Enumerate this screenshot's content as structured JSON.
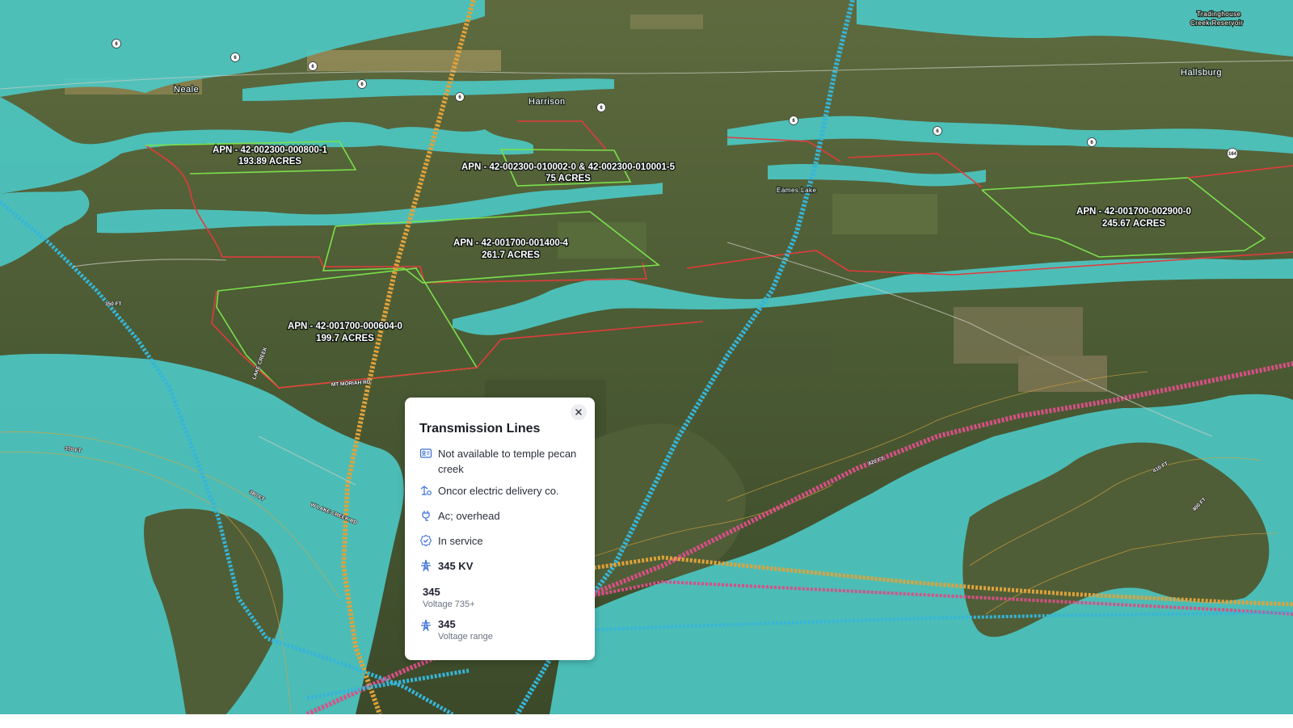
{
  "map": {
    "places": [
      "Neale",
      "Harrison",
      "Hallsburg",
      "Eames Lake",
      "Tradinghouse",
      "Creek Reservoir"
    ],
    "parcels": [
      {
        "apn": "APN - 42-002300-000800-1",
        "acres": "193.89 ACRES"
      },
      {
        "apn": "APN - 42-002300-010002-0 & 42-002300-010001-5",
        "acres": "75 ACRES"
      },
      {
        "apn": "APN - 42-001700-001400-4",
        "acres": "261.7 ACRES"
      },
      {
        "apn": "APN - 42-001700-000604-0",
        "acres": "199.7 ACRES"
      },
      {
        "apn": "APN - 42-001700-002900-0",
        "acres": "245.67 ACRES"
      }
    ],
    "contours": [
      "370 FT",
      "380 FT",
      "400 FT",
      "410 FT",
      "420 FT",
      "350 FT"
    ],
    "roads": [
      "W LAKE CREEK RD",
      "MT MORIAH RD",
      "LAKE CREEK"
    ],
    "shields": [
      "6",
      "6",
      "6",
      "6",
      "6",
      "6",
      "6",
      "6",
      "6",
      "164"
    ],
    "colors": {
      "water": "#4cc9c5",
      "transmission_cyan": "#36b5d8",
      "transmission_orange": "#e0a23a",
      "transmission_pink": "#d94f86",
      "parcel_green": "#7be04a",
      "parcel_red": "#e33b3b"
    }
  },
  "popup": {
    "title": "Transmission Lines",
    "availability": "Not available to temple pecan creek",
    "owner": "Oncor electric delivery co.",
    "type": "Ac; overhead",
    "status": "In service",
    "kv": "345 KV",
    "voltage_value": "345",
    "voltage_label": "Voltage 735+",
    "range_value": "345",
    "range_label": "Voltage range",
    "icons": [
      "id-card-icon",
      "power-line-icon",
      "plug-icon",
      "check-badge-icon",
      "tower-icon",
      "tower-icon"
    ]
  }
}
